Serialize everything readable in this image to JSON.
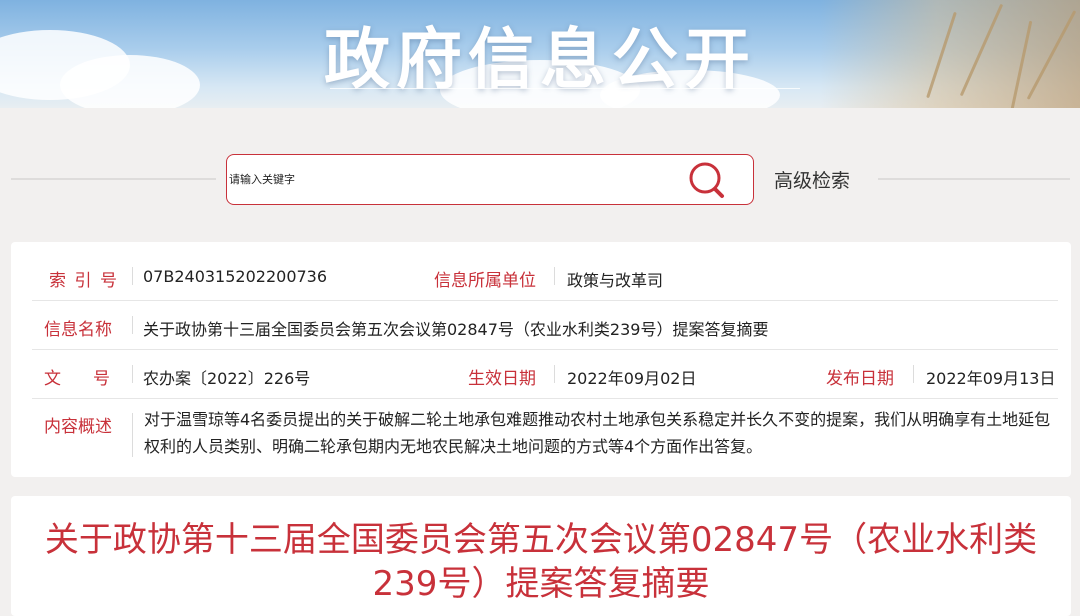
{
  "banner": {
    "title": "政府信息公开"
  },
  "search": {
    "placeholder": "请输入关键字",
    "icon": "search-icon",
    "advanced_label": "高级检索"
  },
  "info": {
    "index_label": [
      "索",
      "引",
      "号"
    ],
    "index_value": "07B240315202200736",
    "unit_label": "信息所属单位",
    "unit_value": "政策与改革司",
    "name_label": "信息名称",
    "name_value": "关于政协第十三届全国委员会第五次会议第02847号（农业水利类239号）提案答复摘要",
    "doc_label": [
      "文",
      "号"
    ],
    "doc_value": "农办案〔2022〕226号",
    "effective_label": "生效日期",
    "effective_value": "2022年09月02日",
    "publish_label": "发布日期",
    "publish_value": "2022年09月13日",
    "summary_label": "内容概述",
    "summary_value": "对于温雪琼等4名委员提出的关于破解二轮土地承包难题推动农村土地承包关系稳定并长久不变的提案，我们从明确享有土地延包权利的人员类别、明确二轮承包期内无地农民解决土地问题的方式等4个方面作出答复。"
  },
  "article": {
    "title": "关于政协第十三届全国委员会第五次会议第02847号（农业水利类239号）提案答复摘要"
  },
  "colors": {
    "accent": "#c8313a",
    "background": "#f2f0ef"
  }
}
